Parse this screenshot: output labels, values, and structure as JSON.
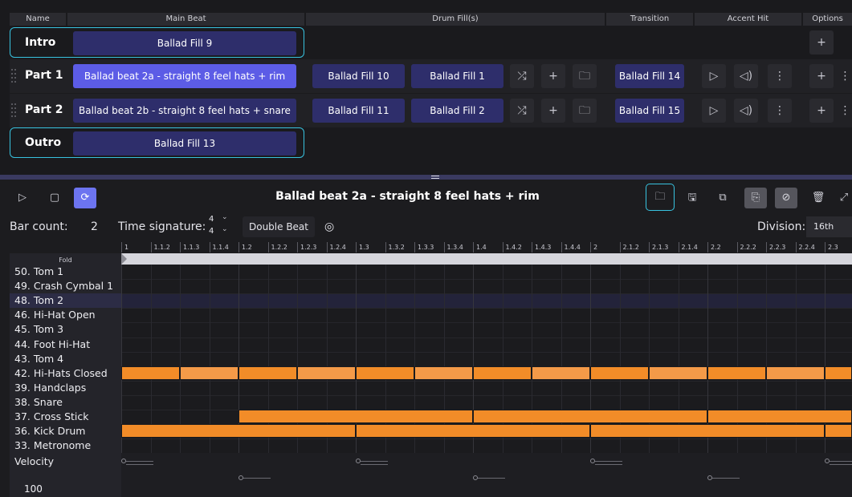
{
  "headers": {
    "name": "Name",
    "main_beat": "Main Beat",
    "drum_fills": "Drum Fill(s)",
    "transition": "Transition",
    "accent_hit": "Accent Hit",
    "options": "Options"
  },
  "sections": [
    {
      "name": "Intro",
      "main_beat": "Ballad Fill 9"
    },
    {
      "name": "Part 1",
      "main_beat": "Ballad beat 2a - straight 8 feel hats + rim",
      "fills": [
        "Ballad Fill 10",
        "Ballad Fill 1"
      ],
      "transition": "Ballad Fill 14"
    },
    {
      "name": "Part 2",
      "main_beat": "Ballad beat 2b - straight 8 feel hats + snare",
      "fills": [
        "Ballad Fill 11",
        "Ballad Fill 2"
      ],
      "transition": "Ballad Fill 15"
    },
    {
      "name": "Outro",
      "main_beat": "Ballad Fill 13"
    }
  ],
  "icons": {
    "shuffle": "⤮",
    "plus": "+",
    "folder": "🗀",
    "play": "▷",
    "speaker": "◁)",
    "more": "⋮",
    "stop": "▢",
    "loop": "⟳",
    "save": "🖫",
    "copy": "⧉",
    "paste": "⎘",
    "unlink": "⊘",
    "trash": "🗑",
    "expand": "⤢",
    "target": "◎",
    "chevron": "⌄",
    "grip": "⋮⋮"
  },
  "editor": {
    "title": "Ballad beat 2a - straight 8 feel hats + rim",
    "bar_count_label": "Bar count:",
    "bar_count": "2",
    "time_sig_label": "Time signature:",
    "time_sig_num": "4",
    "time_sig_den": "4",
    "double_beat": "Double Beat",
    "division_label": "Division:",
    "division": "16th",
    "fold": "Fold",
    "velocity_label": "Velocity",
    "velocity_value": "100"
  },
  "ruler": [
    "1",
    "1.1.2",
    "1.1.3",
    "1.1.4",
    "1.2",
    "1.2.2",
    "1.2.3",
    "1.2.4",
    "1.3",
    "1.3.2",
    "1.3.3",
    "1.3.4",
    "1.4",
    "1.4.2",
    "1.4.3",
    "1.4.4",
    "2",
    "2.1.2",
    "2.1.3",
    "2.1.4",
    "2.2",
    "2.2.2",
    "2.2.3",
    "2.2.4",
    "2.3"
  ],
  "instruments": [
    "50. Tom 1",
    "49. Crash Cymbal 1",
    "48. Tom 2",
    "46. Hi-Hat Open",
    "45. Tom 3",
    "44. Foot Hi-Hat",
    "43. Tom 4",
    "42. Hi-Hats Closed",
    "39. Handclaps",
    "38. Snare",
    "37. Cross Stick",
    "36. Kick Drum",
    "33. Metronome"
  ],
  "notes": [
    {
      "row": 7,
      "start": 0,
      "len": 2
    },
    {
      "row": 7,
      "start": 2,
      "len": 2
    },
    {
      "row": 7,
      "start": 4,
      "len": 2
    },
    {
      "row": 7,
      "start": 6,
      "len": 2
    },
    {
      "row": 7,
      "start": 8,
      "len": 2
    },
    {
      "row": 7,
      "start": 10,
      "len": 2
    },
    {
      "row": 7,
      "start": 12,
      "len": 2
    },
    {
      "row": 7,
      "start": 14,
      "len": 2
    },
    {
      "row": 7,
      "start": 16,
      "len": 2
    },
    {
      "row": 7,
      "start": 18,
      "len": 2
    },
    {
      "row": 7,
      "start": 20,
      "len": 2
    },
    {
      "row": 7,
      "start": 22,
      "len": 2
    },
    {
      "row": 7,
      "start": 24,
      "len": 1
    },
    {
      "row": 10,
      "start": 4,
      "len": 8
    },
    {
      "row": 10,
      "start": 12,
      "len": 8
    },
    {
      "row": 10,
      "start": 20,
      "len": 5
    },
    {
      "row": 11,
      "start": 0,
      "len": 8
    },
    {
      "row": 11,
      "start": 8,
      "len": 8
    },
    {
      "row": 11,
      "start": 16,
      "len": 8
    },
    {
      "row": 11,
      "start": 24,
      "len": 1
    }
  ]
}
